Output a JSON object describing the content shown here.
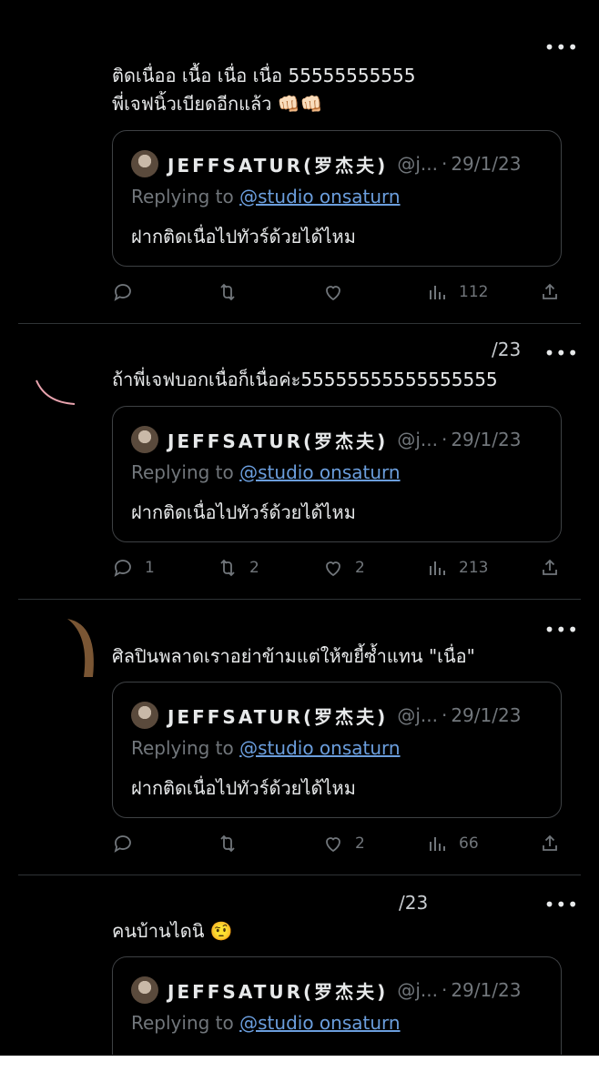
{
  "more_label": "•••",
  "tweets": [
    {
      "text": "ติดเนื่ออ เนื้อ เนื่อ เนื่อ 55555555555\nพี่เจฟนิ้วเบียดอีกแล้ว 👊🏻👊🏻",
      "partial_header": "",
      "quote": {
        "name": "JEFFSATUR(罗杰夫)",
        "handle": "@j...",
        "separator": "·",
        "date": "29/1/23",
        "replying_prefix": "Replying to ",
        "replying_handle": "@studio onsaturn",
        "text": "ฝากติดเนื่อไปทัวร์ด้วยได้ไหม"
      },
      "stats": {
        "reply": "",
        "retweet": "",
        "like": "",
        "views": "112"
      }
    },
    {
      "text": "ถ้าพี่เจฟบอกเนื่อก็เนื่อค่ะ55555555555555555",
      "partial_header": "/23",
      "quote": {
        "name": "JEFFSATUR(罗杰夫)",
        "handle": "@j...",
        "separator": "·",
        "date": "29/1/23",
        "replying_prefix": "Replying to ",
        "replying_handle": "@studio onsaturn",
        "text": "ฝากติดเนื่อไปทัวร์ด้วยได้ไหม"
      },
      "stats": {
        "reply": "1",
        "retweet": "2",
        "like": "2",
        "views": "213"
      }
    },
    {
      "text": "ศิลปินพลาดเราอย่าข้ามแต่ให้ขยี้ซ้ำแทน \"เนื่อ\"",
      "partial_header": "",
      "quote": {
        "name": "JEFFSATUR(罗杰夫)",
        "handle": "@j...",
        "separator": "·",
        "date": "29/1/23",
        "replying_prefix": "Replying to ",
        "replying_handle": "@studio onsaturn",
        "text": "ฝากติดเนื่อไปทัวร์ด้วยได้ไหม"
      },
      "stats": {
        "reply": "",
        "retweet": "",
        "like": "2",
        "views": "66"
      }
    },
    {
      "text": "คนบ้านไดนิ 🤨",
      "partial_header": "/23",
      "quote": {
        "name": "JEFFSATUR(罗杰夫)",
        "handle": "@j...",
        "separator": "·",
        "date": "29/1/23",
        "replying_prefix": "Replying to ",
        "replying_handle": "@studio onsaturn",
        "text": ""
      }
    }
  ]
}
